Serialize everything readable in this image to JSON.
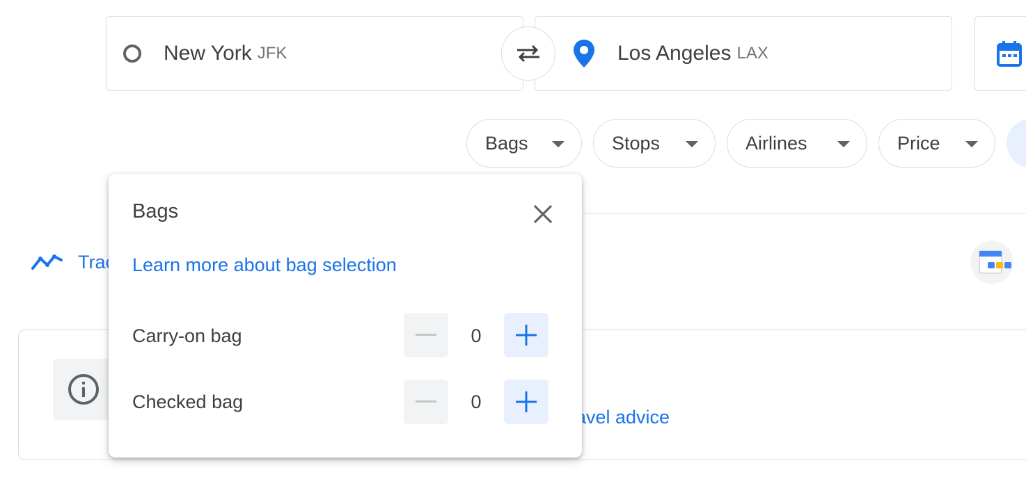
{
  "search": {
    "origin": {
      "city": "New York",
      "code": "JFK"
    },
    "destination": {
      "city": "Los Angeles",
      "code": "LAX"
    }
  },
  "filters": {
    "chips": [
      {
        "label": "Bags"
      },
      {
        "label": "Stops"
      },
      {
        "label": "Airlines"
      },
      {
        "label": "Price"
      }
    ]
  },
  "track": {
    "label": "Trac"
  },
  "advice": {
    "label": "ravel advice"
  },
  "bags_popup": {
    "title": "Bags",
    "learn_more": "Learn more about bag selection",
    "rows": [
      {
        "label": "Carry-on bag",
        "value": "0"
      },
      {
        "label": "Checked bag",
        "value": "0"
      }
    ]
  },
  "colors": {
    "accent": "#1a73e8",
    "border": "#dadce0",
    "text": "#3c4043"
  }
}
